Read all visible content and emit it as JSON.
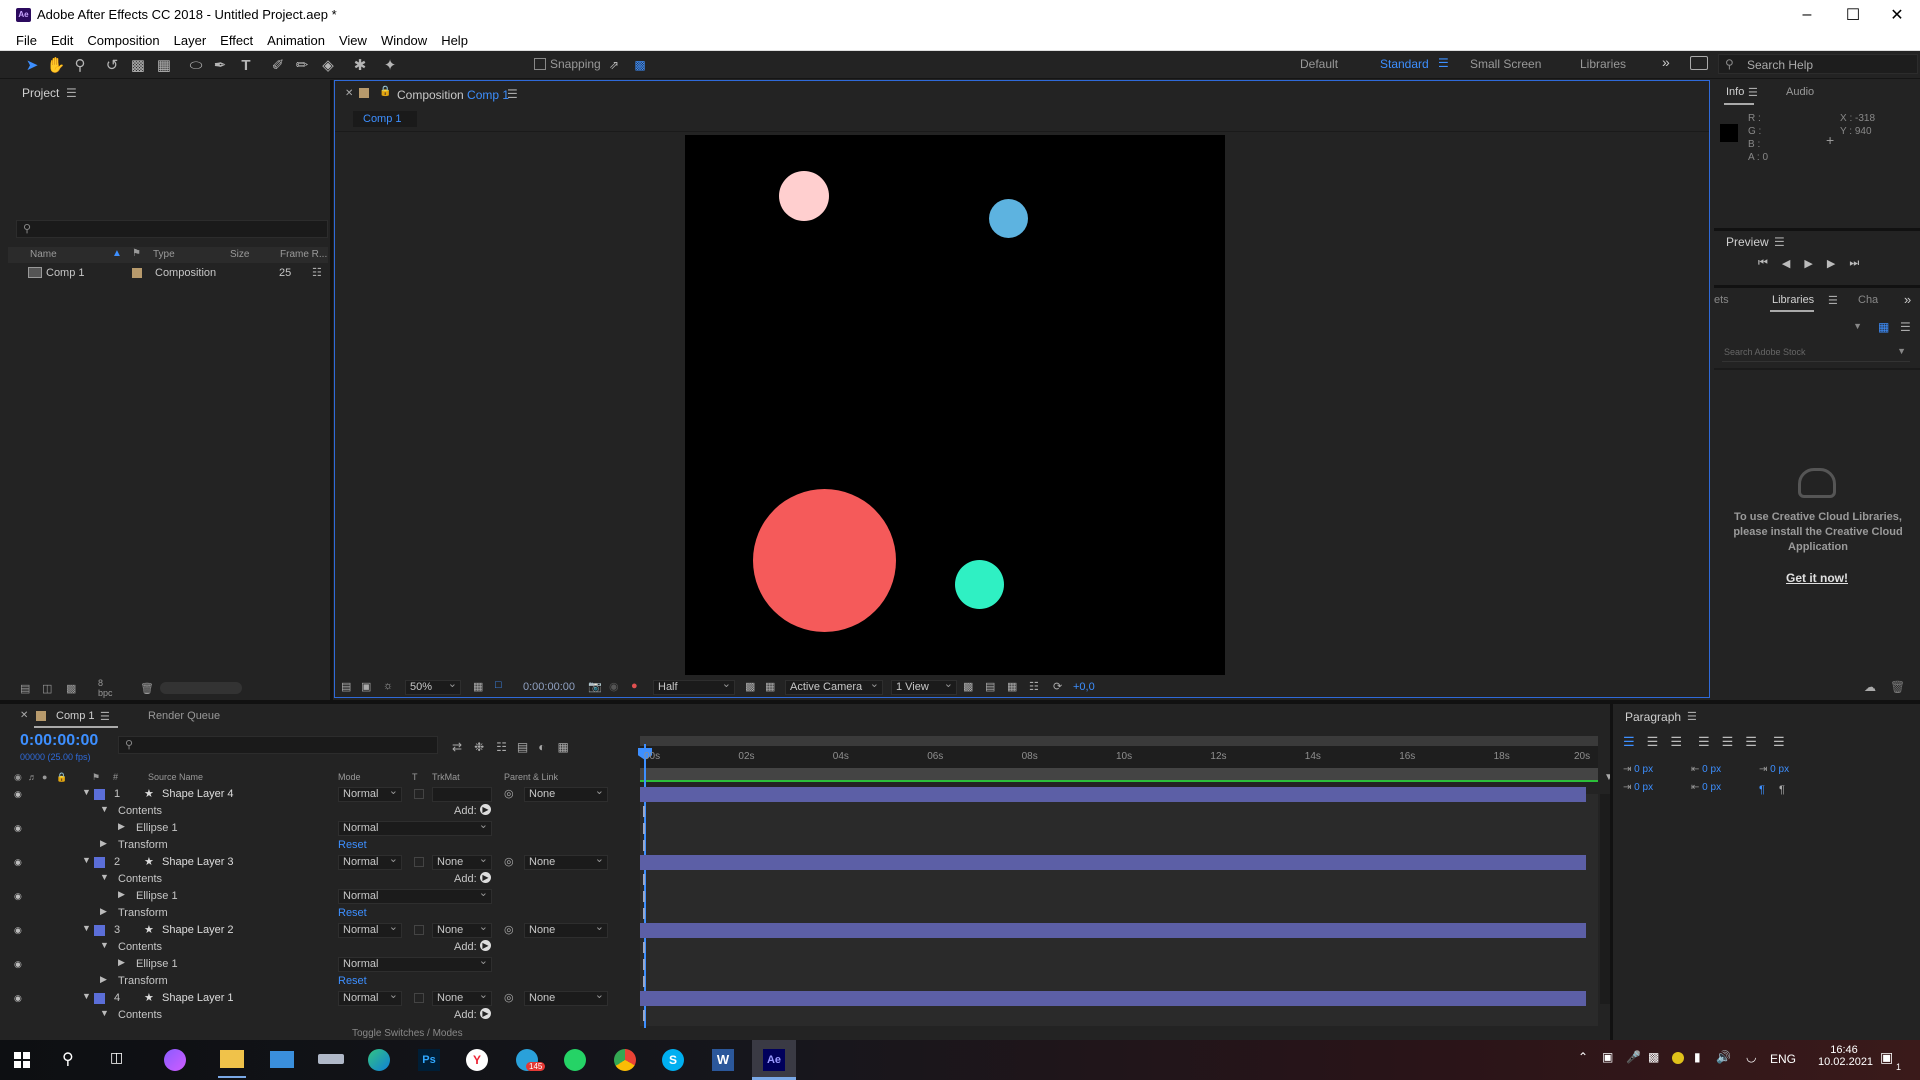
{
  "window": {
    "title": "Adobe After Effects CC 2018 - Untitled Project.aep *",
    "app_icon_text": "Ae"
  },
  "menu": [
    "File",
    "Edit",
    "Composition",
    "Layer",
    "Effect",
    "Animation",
    "View",
    "Window",
    "Help"
  ],
  "toolbar": {
    "snapping_label": "Snapping",
    "search_placeholder": "Search Help"
  },
  "workspaces": [
    "Default",
    "Standard",
    "Small Screen",
    "Libraries"
  ],
  "active_workspace": "Standard",
  "project": {
    "title": "Project",
    "columns": [
      "Name",
      "Type",
      "Size",
      "Frame R..."
    ],
    "items": [
      {
        "name": "Comp 1",
        "type": "Composition",
        "fps": "25"
      }
    ],
    "bpc": "8 bpc"
  },
  "composition": {
    "tab_prefix": "Composition",
    "tab_name": "Comp 1",
    "subtab": "Comp 1",
    "zoom": "50%",
    "timecode": "0:00:00:00",
    "resolution": "Half",
    "camera": "Active Camera",
    "views": "1 View",
    "exposure": "+0,0",
    "circles": [
      {
        "name": "pink-circle",
        "color": "#ffcfcf"
      },
      {
        "name": "blue-circle",
        "color": "#5db3e0"
      },
      {
        "name": "red-circle",
        "color": "#f55a5a"
      },
      {
        "name": "teal-circle",
        "color": "#2ff0c3"
      }
    ]
  },
  "info": {
    "tab_info": "Info",
    "tab_audio": "Audio",
    "r": "R :",
    "g": "G :",
    "b": "B :",
    "a": "A : 0",
    "x": "X : -318",
    "y": "Y : 940"
  },
  "preview": {
    "title": "Preview"
  },
  "libraries": {
    "tab_left": "ets",
    "tab_active": "Libraries",
    "tab_right": "Cha",
    "search_placeholder": "Search Adobe Stock",
    "message": "To use Creative Cloud Libraries, please install the Creative Cloud Application",
    "link": "Get it now!"
  },
  "timeline": {
    "tab": "Comp 1",
    "render_queue": "Render Queue",
    "timecode": "0:00:00:00",
    "fps": "00000 (25.00 fps)",
    "columns": {
      "source": "Source Name",
      "mode": "Mode",
      "t": "T",
      "trkmat": "TrkMat",
      "parent": "Parent & Link"
    },
    "ticks": [
      "00s",
      "02s",
      "04s",
      "06s",
      "08s",
      "10s",
      "12s",
      "14s",
      "16s",
      "18s",
      "20s"
    ],
    "rows": [
      {
        "kind": "layer",
        "num": "1",
        "name": "Shape Layer 4",
        "mode": "Normal",
        "trkmat": "",
        "parent": "None"
      },
      {
        "kind": "contents",
        "label": "Contents",
        "add": "Add:"
      },
      {
        "kind": "ellipse",
        "label": "Ellipse 1",
        "mode": "Normal"
      },
      {
        "kind": "transform",
        "label": "Transform",
        "reset": "Reset"
      },
      {
        "kind": "layer",
        "num": "2",
        "name": "Shape Layer 3",
        "mode": "Normal",
        "trkmat": "None",
        "parent": "None"
      },
      {
        "kind": "contents",
        "label": "Contents",
        "add": "Add:"
      },
      {
        "kind": "ellipse",
        "label": "Ellipse 1",
        "mode": "Normal"
      },
      {
        "kind": "transform",
        "label": "Transform",
        "reset": "Reset"
      },
      {
        "kind": "layer",
        "num": "3",
        "name": "Shape Layer 2",
        "mode": "Normal",
        "trkmat": "None",
        "parent": "None"
      },
      {
        "kind": "contents",
        "label": "Contents",
        "add": "Add:"
      },
      {
        "kind": "ellipse",
        "label": "Ellipse 1",
        "mode": "Normal"
      },
      {
        "kind": "transform",
        "label": "Transform",
        "reset": "Reset"
      },
      {
        "kind": "layer",
        "num": "4",
        "name": "Shape Layer 1",
        "mode": "Normal",
        "trkmat": "None",
        "parent": "None"
      },
      {
        "kind": "contents",
        "label": "Contents",
        "add": "Add:"
      }
    ],
    "toggle": "Toggle Switches / Modes"
  },
  "paragraph": {
    "title": "Paragraph",
    "values": [
      "0 px",
      "0 px",
      "0 px",
      "0 px",
      "0 px"
    ]
  },
  "taskbar": {
    "lang": "ENG",
    "time": "16:46",
    "date": "10.02.2021",
    "telegram_badge": "145",
    "notif": "1"
  }
}
